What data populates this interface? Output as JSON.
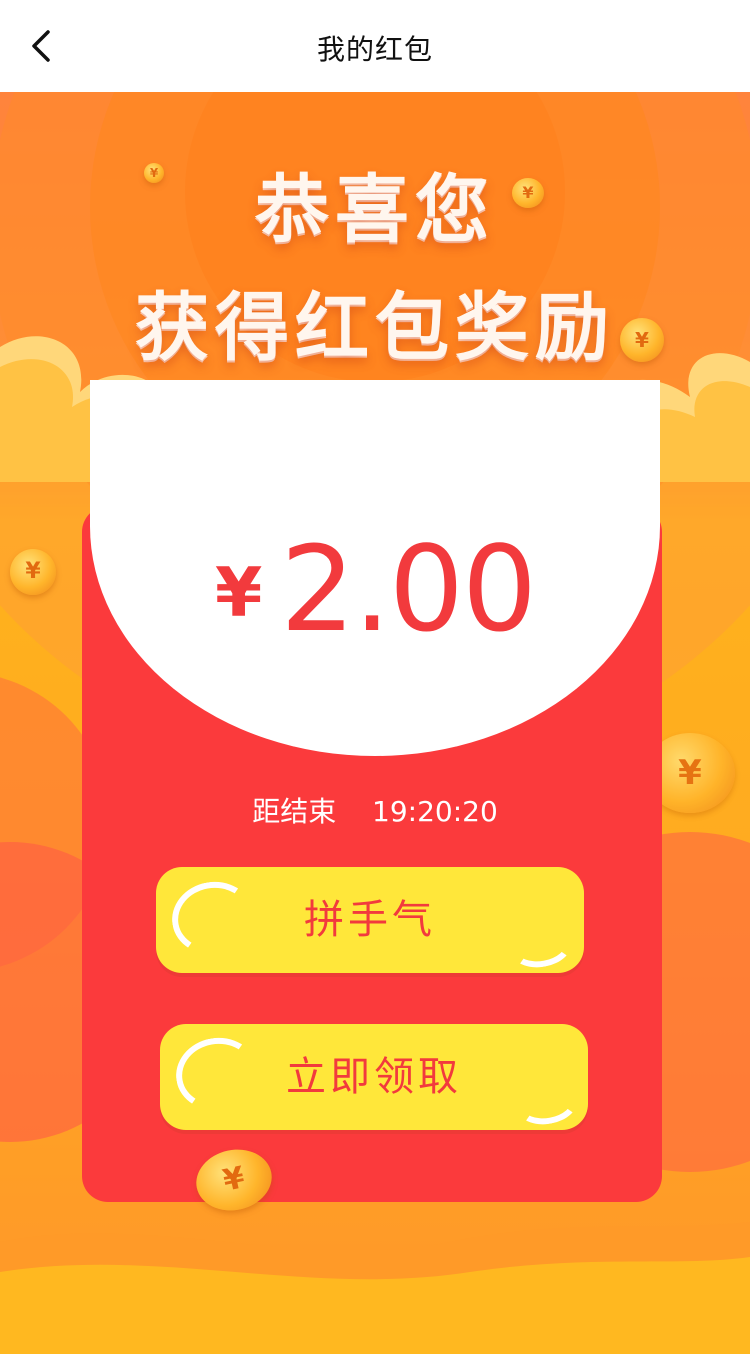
{
  "nav": {
    "title": "我的红包",
    "back_icon": "chevron-left-icon"
  },
  "banner": {
    "line1": "恭喜您",
    "line2": "获得红包奖励"
  },
  "reward": {
    "currency": "¥",
    "amount": "2.00"
  },
  "countdown": {
    "label": "距结束",
    "time": "19:20:20"
  },
  "buttons": {
    "luck": "拼手气",
    "claim": "立即领取"
  },
  "coins": {
    "symbol": "¥"
  },
  "colors": {
    "envelope": "#fb3a3c",
    "button": "#ffe73a",
    "accent_text": "#f23a3d",
    "background": "#ffb21c"
  }
}
